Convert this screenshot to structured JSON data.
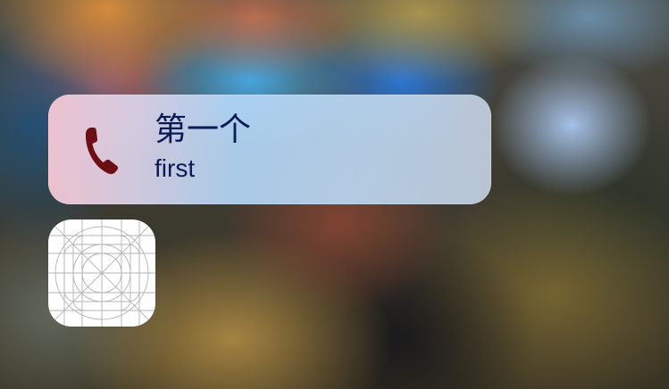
{
  "quick_action": {
    "title": "第一个",
    "subtitle": "first",
    "icon": "phone-icon",
    "icon_color": "#6b0f14"
  },
  "app": {
    "icon": "app-icon-grid-template"
  }
}
